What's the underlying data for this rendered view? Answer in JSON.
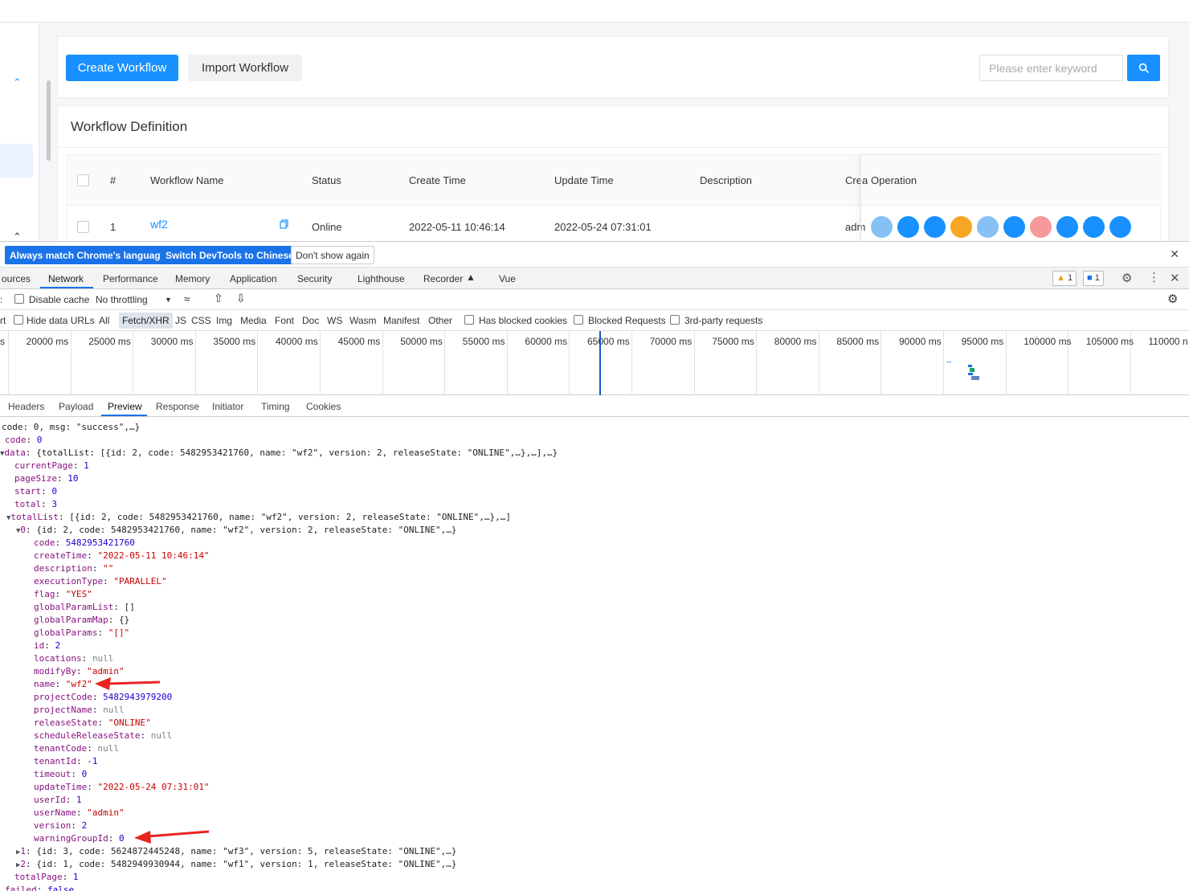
{
  "app": {
    "create_btn": "Create Workflow",
    "import_btn": "Import Workflow",
    "search_placeholder": "Please enter keyword",
    "section_title": "Workflow Definition",
    "columns": [
      "#",
      "Workflow Name",
      "Status",
      "Create Time",
      "Update Time",
      "Description",
      "Crea",
      "Operation"
    ],
    "row": {
      "index": "1",
      "name": "wf2",
      "status": "Online",
      "create_time": "2022-05-11 10:46:14",
      "update_time": "2022-05-24 07:31:01",
      "creator": "adm"
    },
    "op_colors": [
      "#85c1f5",
      "#1890ff",
      "#1890ff",
      "#f5a623",
      "#85c1f5",
      "#1890ff",
      "#f5999a",
      "#1890ff",
      "#1890ff",
      "#1890ff"
    ]
  },
  "devtools": {
    "infobar": {
      "btn_match": "Always match Chrome's language",
      "btn_switch": "Switch DevTools to Chinese",
      "btn_dont": "Don't show again"
    },
    "tabs": [
      "ources",
      "Network",
      "Performance",
      "Memory",
      "Application",
      "Security",
      "Lighthouse",
      "Recorder",
      "Vue"
    ],
    "active_tab": "Network",
    "warn_count": "1",
    "msg_count": "1",
    "net_toolbar": {
      "disable_cache": "Disable cache",
      "throttling": "No throttling"
    },
    "filters": [
      "rt",
      "Hide data URLs",
      "All",
      "Fetch/XHR",
      "JS",
      "CSS",
      "Img",
      "Media",
      "Font",
      "Doc",
      "WS",
      "Wasm",
      "Manifest",
      "Other",
      "Has blocked cookies",
      "Blocked Requests",
      "3rd-party requests"
    ],
    "overview_ticks": [
      "s",
      "20000 ms",
      "25000 ms",
      "30000 ms",
      "35000 ms",
      "40000 ms",
      "45000 ms",
      "50000 ms",
      "55000 ms",
      "60000 ms",
      "65000 ms",
      "70000 ms",
      "75000 ms",
      "80000 ms",
      "85000 ms",
      "90000 ms",
      "95000 ms",
      "100000 ms",
      "105000 ms",
      "110000 n"
    ],
    "detail_tabs": [
      "Headers",
      "Payload",
      "Preview",
      "Response",
      "Initiator",
      "Timing",
      "Cookies"
    ],
    "active_detail_tab": "Preview",
    "json": {
      "root_summary": "code: 0, msg: \"success\",…}",
      "code": "0",
      "data_summary": "{totalList: [{id: 2, code: 5482953421760, name: \"wf2\", version: 2, releaseState: \"ONLINE\",…},…],…}",
      "currentPage": "1",
      "pageSize": "10",
      "start": "0",
      "total": "3",
      "totalList_summary": "[{id: 2, code: 5482953421760, name: \"wf2\", version: 2, releaseState: \"ONLINE\",…},…]",
      "item0_summary": "{id: 2, code: 5482953421760, name: \"wf2\", version: 2, releaseState: \"ONLINE\",…}",
      "item0": {
        "code": "5482953421760",
        "createTime": "\"2022-05-11 10:46:14\"",
        "description": "\"\"",
        "executionType": "\"PARALLEL\"",
        "flag": "\"YES\"",
        "globalParamList": "[]",
        "globalParamMap": "{}",
        "globalParams": "\"[]\"",
        "id": "2",
        "locations": "null",
        "modifyBy": "\"admin\"",
        "name": "\"wf2\"",
        "projectCode": "5482943979200",
        "projectName": "null",
        "releaseState": "\"ONLINE\"",
        "scheduleReleaseState": "null",
        "tenantCode": "null",
        "tenantId": "-1",
        "timeout": "0",
        "updateTime": "\"2022-05-24 07:31:01\"",
        "userId": "1",
        "userName": "\"admin\"",
        "version": "2",
        "warningGroupId": "0"
      },
      "item1_summary": "{id: 3, code: 5624872445248, name: \"wf3\", version: 5, releaseState: \"ONLINE\",…}",
      "item2_summary": "{id: 1, code: 5482949930944, name: \"wf1\", version: 1, releaseState: \"ONLINE\",…}",
      "totalPage": "1",
      "failed": "false"
    }
  }
}
